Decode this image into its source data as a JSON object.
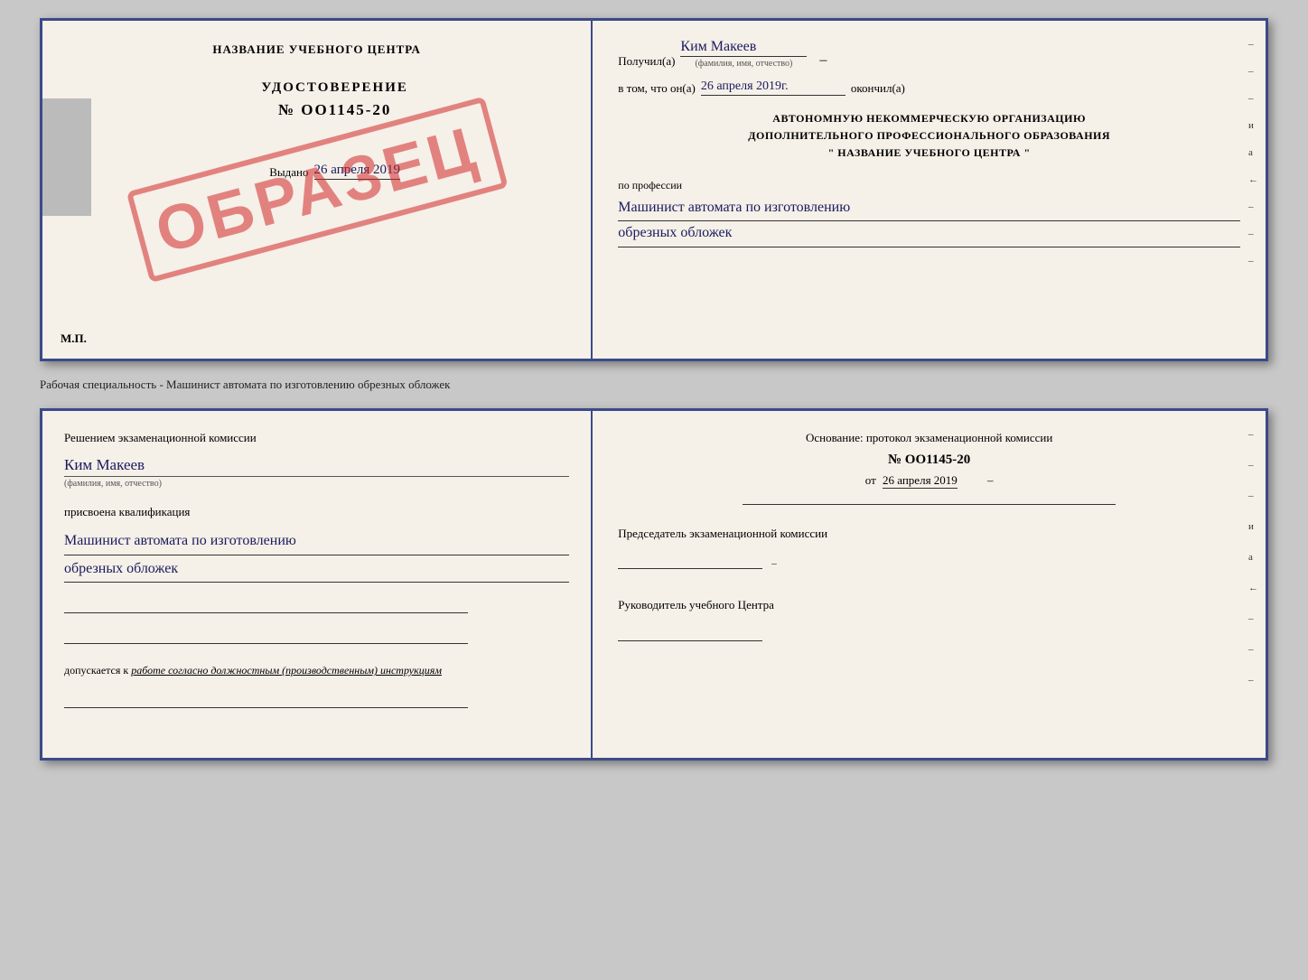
{
  "top_card": {
    "left": {
      "institution_name": "НАЗВАНИЕ УЧЕБНОГО ЦЕНТРА",
      "cert_type": "УДОСТОВЕРЕНИЕ",
      "cert_number": "№ OO1145-20",
      "issued_date_label": "Выдано",
      "issued_date": "26 апреля 2019",
      "stamp": "ОБРАЗЕЦ",
      "mp_label": "М.П."
    },
    "right": {
      "received_label": "Получил(а)",
      "recipient_name": "Ким Макеев",
      "name_subtext": "(фамилия, имя, отчество)",
      "in_that_label": "в том, что он(а)",
      "completion_date": "26 апреля 2019г.",
      "completed_label": "окончил(а)",
      "org_line1": "АВТОНОМНУЮ НЕКОММЕРЧЕСКУЮ ОРГАНИЗАЦИЮ",
      "org_line2": "ДОПОЛНИТЕЛЬНОГО ПРОФЕССИОНАЛЬНОГО ОБРАЗОВАНИЯ",
      "org_line3": "\"  НАЗВАНИЕ УЧЕБНОГО ЦЕНТРА  \"",
      "profession_label": "по профессии",
      "profession_value_line1": "Машинист автомата по изготовлению",
      "profession_value_line2": "обрезных обложек",
      "side_marks": [
        "-",
        "-",
        "-",
        "и",
        "а",
        "←",
        "-",
        "-",
        "-"
      ]
    }
  },
  "separator": {
    "text": "Рабочая специальность - Машинист автомата по изготовлению обрезных обложек"
  },
  "bottom_card": {
    "left": {
      "decision_label": "Решением экзаменационной комиссии",
      "name_value": "Ким Макеев",
      "name_subtext": "(фамилия, имя, отчество)",
      "qualification_label": "присвоена квалификация",
      "qualification_value_line1": "Машинист автомата по изготовлению",
      "qualification_value_line2": "обрезных обложек",
      "допуск_label": "допускается к",
      "допуск_value": "работе согласно должностным (производственным) инструкциям"
    },
    "right": {
      "basis_label": "Основание: протокол экзаменационной комиссии",
      "protocol_number": "№ OO1145-20",
      "protocol_date_prefix": "от",
      "protocol_date": "26 апреля 2019",
      "chairman_label": "Председатель экзаменационной комиссии",
      "director_label": "Руководитель учебного Центра",
      "side_marks": [
        "-",
        "-",
        "-",
        "и",
        "а",
        "←",
        "-",
        "-",
        "-"
      ]
    }
  }
}
